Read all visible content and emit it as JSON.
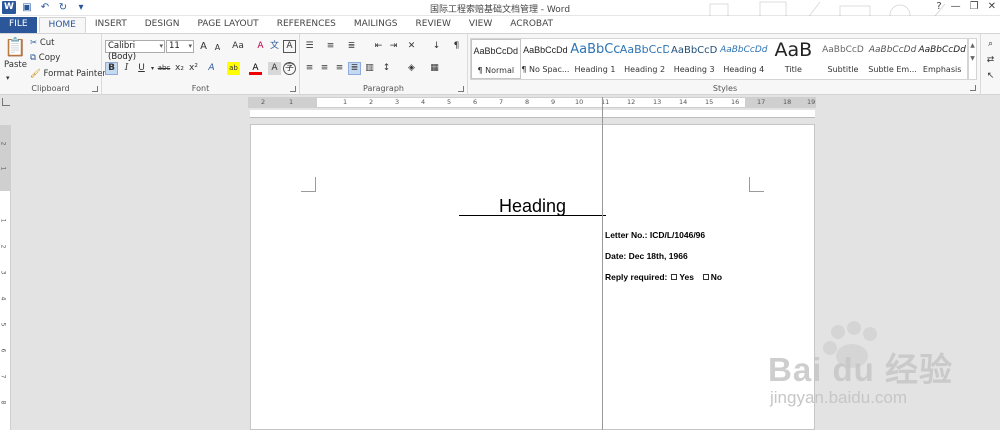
{
  "window": {
    "title": "国际工程索赔基础文档管理 - Word",
    "help": "?",
    "minimize": "—",
    "restore": "❐",
    "close": "✕"
  },
  "tabs": [
    "FILE",
    "HOME",
    "INSERT",
    "DESIGN",
    "PAGE LAYOUT",
    "REFERENCES",
    "MAILINGS",
    "REVIEW",
    "VIEW",
    "ACROBAT"
  ],
  "clipboard": {
    "paste": "Paste",
    "cut": "Cut",
    "copy": "Copy",
    "format_painter": "Format Painter",
    "label": "Clipboard"
  },
  "font": {
    "name": "Calibri (Body)",
    "size": "11",
    "label": "Font",
    "grow": "A",
    "shrink": "A",
    "case": "Aa",
    "bold": "B",
    "italic": "I",
    "underline": "U",
    "strike": "abc",
    "sub": "x₂",
    "sup": "x²",
    "clear": "A",
    "effects": "A",
    "highlight": "ab",
    "color": "A",
    "char_shade": "A",
    "enclose": "A"
  },
  "paragraph": {
    "label": "Paragraph"
  },
  "styles": {
    "label": "Styles",
    "items": [
      {
        "sample": "AaBbCcDd",
        "name": "¶ Normal"
      },
      {
        "sample": "AaBbCcDd",
        "name": "¶ No Spac..."
      },
      {
        "sample": "AaBbCc",
        "name": "Heading 1"
      },
      {
        "sample": "AaBbCcD",
        "name": "Heading 2"
      },
      {
        "sample": "AaBbCcD",
        "name": "Heading 3"
      },
      {
        "sample": "AaBbCcDd",
        "name": "Heading 4"
      },
      {
        "sample": "AaB",
        "name": "Title"
      },
      {
        "sample": "AaBbCcD",
        "name": "Subtitle"
      },
      {
        "sample": "AaBbCcDd",
        "name": "Subtle Em..."
      },
      {
        "sample": "AaBbCcDd",
        "name": "Emphasis"
      }
    ]
  },
  "ruler": {
    "numbers": [
      "2",
      "1",
      "1",
      "2",
      "3",
      "4",
      "5",
      "6",
      "7",
      "8",
      "9",
      "10",
      "11",
      "12",
      "13",
      "14",
      "15",
      "16",
      "17",
      "18",
      "19"
    ]
  },
  "vruler": {
    "numbers": [
      "2",
      "1",
      "1",
      "2",
      "3",
      "4",
      "5",
      "6",
      "7",
      "8"
    ]
  },
  "document": {
    "heading": "Heading",
    "letter_no": "Letter No.: ICD/L/1046/96",
    "date": "Date: Dec 18th, 1966",
    "reply": "Reply required:",
    "yes": "Yes",
    "no": "No"
  },
  "watermark": {
    "brand": "Bai du 经验",
    "url": "jingyan.baidu.com"
  },
  "colors": {
    "word_blue": "#2b579a",
    "ribbon_bg": "#f7f7f7",
    "canvas": "#e3e3e3"
  }
}
